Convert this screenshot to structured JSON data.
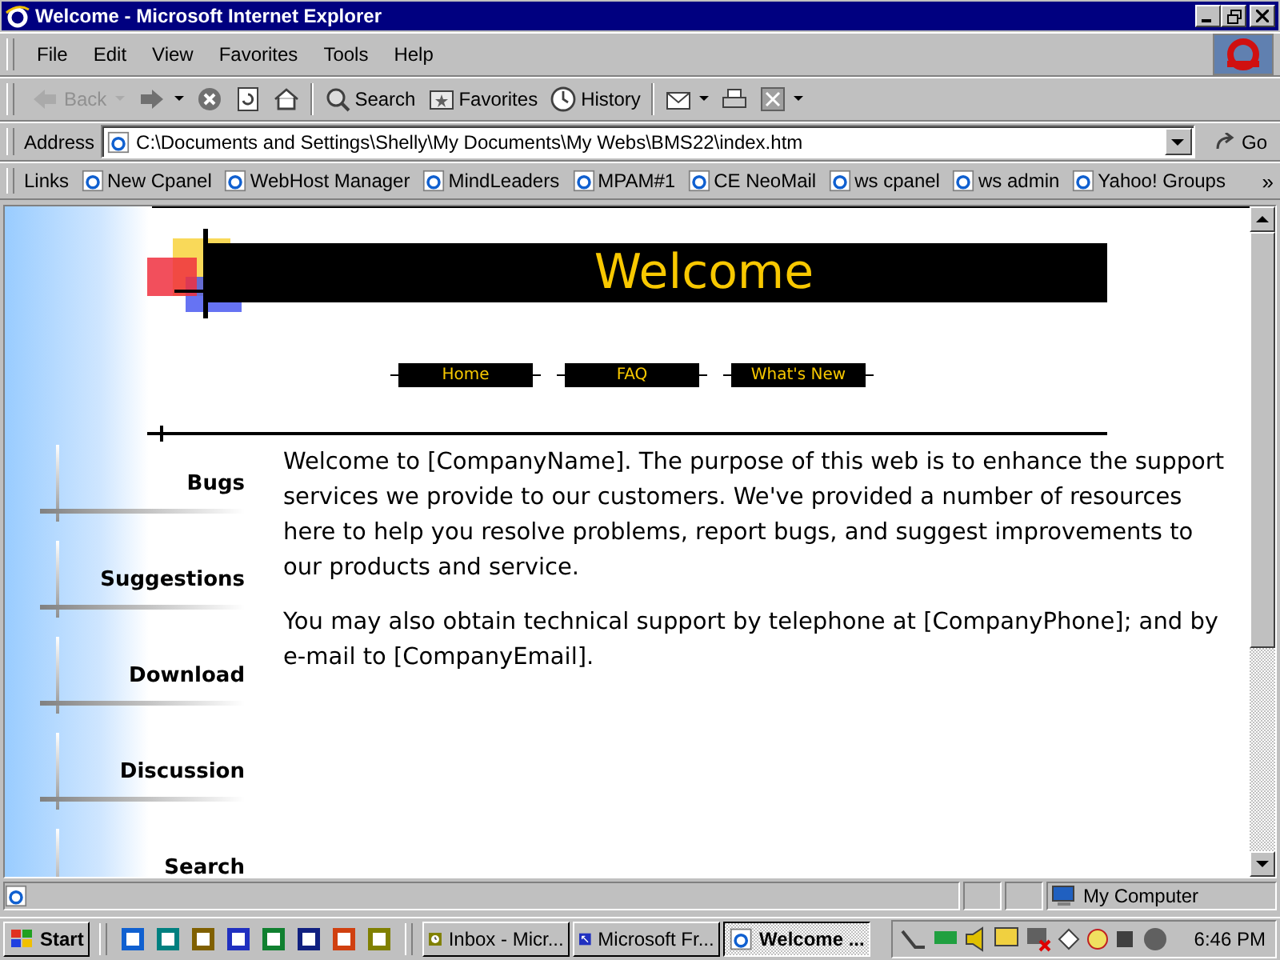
{
  "window": {
    "title": "Welcome - Microsoft Internet Explorer"
  },
  "menu": [
    "File",
    "Edit",
    "View",
    "Favorites",
    "Tools",
    "Help"
  ],
  "toolbar": [
    {
      "kind": "back",
      "label": "Back",
      "disabled": true
    },
    {
      "kind": "forward",
      "disabled": false
    },
    {
      "kind": "stop",
      "disabled": false
    },
    {
      "kind": "refresh",
      "disabled": false
    },
    {
      "kind": "home",
      "disabled": false
    },
    {
      "kind": "search",
      "label": "Search",
      "disabled": false
    },
    {
      "kind": "favorites",
      "label": "Favorites",
      "disabled": false
    },
    {
      "kind": "history",
      "label": "History",
      "disabled": false
    },
    {
      "kind": "mail",
      "disabled": false
    },
    {
      "kind": "print",
      "disabled": false
    },
    {
      "kind": "edit",
      "disabled": false
    }
  ],
  "address": {
    "label": "Address",
    "value": "C:\\Documents and Settings\\Shelly\\My Documents\\My Webs\\BMS22\\index.htm",
    "go": "Go"
  },
  "links": {
    "label": "Links",
    "items": [
      "New Cpanel",
      "WebHost Manager",
      "MindLeaders",
      "MPAM#1",
      "CE NeoMail",
      "ws cpanel",
      "ws admin",
      "Yahoo! Groups"
    ],
    "more": "»"
  },
  "page": {
    "heading": "Welcome",
    "nav": [
      "Home",
      "FAQ",
      "What's New"
    ],
    "sidebar": [
      "Bugs",
      "Suggestions",
      "Download",
      "Discussion",
      "Search"
    ],
    "paragraphs": [
      "Welcome to [CompanyName]. The purpose of this web is to enhance the support services we provide to our customers. We've provided a number of resources here to help you resolve problems, report bugs, and suggest improvements to our products and service.",
      "You may also obtain technical support by telephone at [CompanyPhone]; and by e-mail to [CompanyEmail]."
    ]
  },
  "status_bar": {
    "zone": "My Computer"
  },
  "taskbar": {
    "start": "Start",
    "quick_launch": [
      {
        "color": "#1060d0"
      },
      {
        "color": "#008080"
      },
      {
        "color": "#806000"
      },
      {
        "color": "#2030c0"
      },
      {
        "color": "#108030"
      },
      {
        "color": "#102080"
      },
      {
        "color": "#d04010"
      },
      {
        "color": "#808000"
      }
    ],
    "tasks": [
      {
        "label": "Inbox - Micr...",
        "selected": false,
        "kind": "clock"
      },
      {
        "label": "Microsoft Fr...",
        "selected": false,
        "kind": "arrows"
      },
      {
        "label": "Welcome ...",
        "selected": true,
        "kind": "browser"
      }
    ],
    "clock": "6:46 PM"
  }
}
